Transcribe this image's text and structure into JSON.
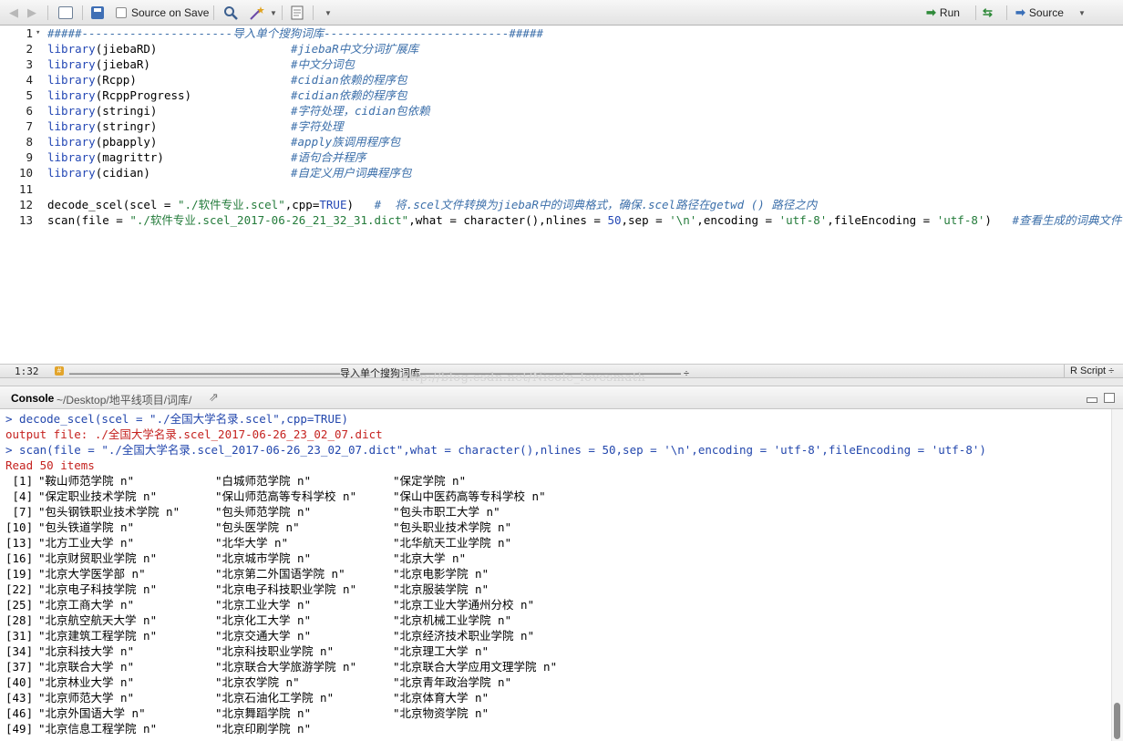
{
  "toolbar": {
    "source_on_save_label": "Source on Save",
    "run_label": "Run",
    "source_label": "Source"
  },
  "editor": {
    "lines": [
      {
        "n": "1",
        "fold": "▾",
        "parts": [
          {
            "t": "#####----------------------导入单个搜狗词库---------------------------#####",
            "k": "cm"
          }
        ]
      },
      {
        "n": "2",
        "parts": [
          {
            "t": "library",
            "k": "fn"
          },
          {
            "t": "(jiebaRD)",
            "k": ""
          }
        ],
        "comment": "#jiebaR中文分词扩展库"
      },
      {
        "n": "3",
        "parts": [
          {
            "t": "library",
            "k": "fn"
          },
          {
            "t": "(jiebaR)",
            "k": ""
          }
        ],
        "comment": "#中文分词包"
      },
      {
        "n": "4",
        "parts": [
          {
            "t": "library",
            "k": "fn"
          },
          {
            "t": "(Rcpp)",
            "k": ""
          }
        ],
        "comment": "#cidian依赖的程序包"
      },
      {
        "n": "5",
        "parts": [
          {
            "t": "library",
            "k": "fn"
          },
          {
            "t": "(RcppProgress)",
            "k": ""
          }
        ],
        "comment": "#cidian依赖的程序包"
      },
      {
        "n": "6",
        "parts": [
          {
            "t": "library",
            "k": "fn"
          },
          {
            "t": "(stringi)",
            "k": ""
          }
        ],
        "comment": "#字符处理，cidian包依赖"
      },
      {
        "n": "7",
        "parts": [
          {
            "t": "library",
            "k": "fn"
          },
          {
            "t": "(stringr)",
            "k": ""
          }
        ],
        "comment": "#字符处理"
      },
      {
        "n": "8",
        "parts": [
          {
            "t": "library",
            "k": "fn"
          },
          {
            "t": "(pbapply)",
            "k": ""
          }
        ],
        "comment": "#apply族调用程序包"
      },
      {
        "n": "9",
        "parts": [
          {
            "t": "library",
            "k": "fn"
          },
          {
            "t": "(magrittr)",
            "k": ""
          }
        ],
        "comment": "#语句合并程序"
      },
      {
        "n": "10",
        "parts": [
          {
            "t": "library",
            "k": "fn"
          },
          {
            "t": "(cidian)",
            "k": ""
          }
        ],
        "comment": "#自定义用户词典程序包"
      },
      {
        "n": "11",
        "parts": []
      },
      {
        "n": "12",
        "parts": [
          {
            "t": "decode_scel(scel = ",
            "k": ""
          },
          {
            "t": "\"./软件专业.scel\"",
            "k": "str"
          },
          {
            "t": ",cpp=",
            "k": ""
          },
          {
            "t": "TRUE",
            "k": "kw"
          },
          {
            "t": ")   ",
            "k": ""
          },
          {
            "t": "#  将.scel文件转换为jiebaR中的词典格式，确保.scel路径在getwd () 路径之内",
            "k": "cm"
          }
        ]
      },
      {
        "n": "13",
        "parts": [
          {
            "t": "scan(file = ",
            "k": ""
          },
          {
            "t": "\"./软件专业.scel_2017-06-26_21_32_31.dict\"",
            "k": "str"
          },
          {
            "t": ",what = character(),nlines = ",
            "k": ""
          },
          {
            "t": "50",
            "k": "num"
          },
          {
            "t": ",sep = ",
            "k": ""
          },
          {
            "t": "'\\n'",
            "k": "str"
          },
          {
            "t": ",encoding = ",
            "k": ""
          },
          {
            "t": "'utf-8'",
            "k": "str"
          },
          {
            "t": ",fileEncoding = ",
            "k": ""
          },
          {
            "t": "'utf-8'",
            "k": "str"
          },
          {
            "t": ")   ",
            "k": ""
          },
          {
            "t": "#查看生成的词典文件",
            "k": "cm"
          }
        ]
      }
    ]
  },
  "status": {
    "position": "1:32",
    "chip": "#",
    "section": "———————————————————————————导入单个搜狗词库—————————————————————————— ÷",
    "mode": "R Script ÷"
  },
  "watermark": "http://blog.csdn.net/Nicole_lovesmath",
  "console": {
    "title": "Console",
    "path": "~/Desktop/地平线项目/词库/",
    "goto_icon": "⇗",
    "lines": [
      {
        "k": "prompt",
        "t": "> decode_scel(scel = \"./全国大学名录.scel\",cpp=TRUE)"
      },
      {
        "k": "err",
        "t": "output file: ./全国大学名录.scel_2017-06-26_23_02_07.dict"
      },
      {
        "k": "prompt",
        "t": "> scan(file = \"./全国大学名录.scel_2017-06-26_23_02_07.dict\",what = character(),nlines = 50,sep = '\\n',encoding = 'utf-8',fileEncoding = 'utf-8')"
      },
      {
        "k": "err",
        "t": "Read 50 items"
      }
    ],
    "rows": [
      {
        "idx": " [1]",
        "c1": "\"鞍山师范学院 n\"",
        "c2": "\"白城师范学院 n\"",
        "c3": "\"保定学院 n\""
      },
      {
        "idx": " [4]",
        "c1": "\"保定职业技术学院 n\"",
        "c2": "\"保山师范高等专科学校 n\"",
        "c3": "\"保山中医药高等专科学校 n\""
      },
      {
        "idx": " [7]",
        "c1": "\"包头钢铁职业技术学院 n\"",
        "c2": "\"包头师范学院 n\"",
        "c3": "\"包头市职工大学 n\""
      },
      {
        "idx": "[10]",
        "c1": "\"包头铁道学院 n\"",
        "c2": "\"包头医学院 n\"",
        "c3": "\"包头职业技术学院 n\""
      },
      {
        "idx": "[13]",
        "c1": "\"北方工业大学 n\"",
        "c2": "\"北华大学 n\"",
        "c3": "\"北华航天工业学院 n\""
      },
      {
        "idx": "[16]",
        "c1": "\"北京财贸职业学院 n\"",
        "c2": "\"北京城市学院 n\"",
        "c3": "\"北京大学 n\""
      },
      {
        "idx": "[19]",
        "c1": "\"北京大学医学部 n\"",
        "c2": "\"北京第二外国语学院 n\"",
        "c3": "\"北京电影学院 n\""
      },
      {
        "idx": "[22]",
        "c1": "\"北京电子科技学院 n\"",
        "c2": "\"北京电子科技职业学院 n\"",
        "c3": "\"北京服装学院 n\""
      },
      {
        "idx": "[25]",
        "c1": "\"北京工商大学 n\"",
        "c2": "\"北京工业大学 n\"",
        "c3": "\"北京工业大学通州分校 n\""
      },
      {
        "idx": "[28]",
        "c1": "\"北京航空航天大学 n\"",
        "c2": "\"北京化工大学 n\"",
        "c3": "\"北京机械工业学院 n\""
      },
      {
        "idx": "[31]",
        "c1": "\"北京建筑工程学院 n\"",
        "c2": "\"北京交通大学 n\"",
        "c3": "\"北京经济技术职业学院 n\""
      },
      {
        "idx": "[34]",
        "c1": "\"北京科技大学 n\"",
        "c2": "\"北京科技职业学院 n\"",
        "c3": "\"北京理工大学 n\""
      },
      {
        "idx": "[37]",
        "c1": "\"北京联合大学 n\"",
        "c2": "\"北京联合大学旅游学院 n\"",
        "c3": "\"北京联合大学应用文理学院 n\""
      },
      {
        "idx": "[40]",
        "c1": "\"北京林业大学 n\"",
        "c2": "\"北京农学院 n\"",
        "c3": "\"北京青年政治学院 n\""
      },
      {
        "idx": "[43]",
        "c1": "\"北京师范大学 n\"",
        "c2": "\"北京石油化工学院 n\"",
        "c3": "\"北京体育大学 n\""
      },
      {
        "idx": "[46]",
        "c1": "\"北京外国语大学 n\"",
        "c2": "\"北京舞蹈学院 n\"",
        "c3": "\"北京物资学院 n\""
      },
      {
        "idx": "[49]",
        "c1": "\"北京信息工程学院 n\"",
        "c2": "\"北京印刷学院 n\"",
        "c3": ""
      }
    ]
  },
  "colors": {
    "comment": "#3c6faa",
    "function": "#2448b5",
    "string": "#237b3a",
    "prompt": "#2347ad",
    "error": "#c5221f"
  }
}
